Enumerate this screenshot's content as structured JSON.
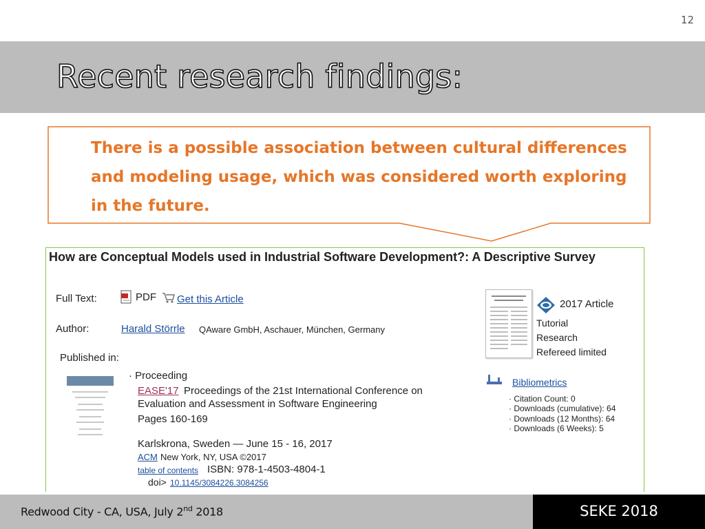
{
  "slide": {
    "number": "12",
    "title": "Recent research findings:",
    "callout_text": "There is a possible association between cultural differences and modeling usage, which was considered worth exploring in the future."
  },
  "paper": {
    "title": "How are Conceptual Models used in Industrial Software Development?: A Descriptive Survey",
    "full_text_label": "Full Text:",
    "pdf_label": "PDF",
    "get_article_label": "Get this Article",
    "author_label": "Author:",
    "author_name": "Harald Störrle",
    "author_affiliation": "QAware GmbH, Aschauer, München, Germany",
    "published_in_label": "Published in:",
    "proceeding_label": "· Proceeding",
    "conference_abbrev": "EASE'17",
    "conference_title_1": "Proceedings of the 21st International Conference on",
    "conference_title_2": "Evaluation and Assessment in Software Engineering",
    "pages": "Pages 160-169",
    "location": "Karlskrona, Sweden — June 15 - 16, 2017",
    "publisher_link": "ACM",
    "publisher_info": "New York, NY, USA ©2017",
    "toc_link": "table of contents",
    "isbn": "ISBN: 978-1-4503-4804-1",
    "doi_label": "doi>",
    "doi_link": "10.1145/3084226.3084256",
    "article_year_type": "2017 Article",
    "tags": [
      "Tutorial",
      "Research",
      "Refereed limited"
    ],
    "bibliometrics_label": "Bibliometrics",
    "metrics": [
      "· Citation Count: 0",
      "· Downloads (cumulative): 64",
      "· Downloads (12 Months): 64",
      "· Downloads (6 Weeks): 5"
    ]
  },
  "footer": {
    "location_prefix": "Redwood City - CA, USA, July 2",
    "location_sup": "nd",
    "location_suffix": " 2018",
    "conference": "SEKE 2018"
  },
  "colors": {
    "title_band": "#bcbcbc",
    "callout": "#e67628",
    "paper_border": "#8bc34a",
    "link": "#1a4e9e",
    "footer_right": "#000000"
  }
}
